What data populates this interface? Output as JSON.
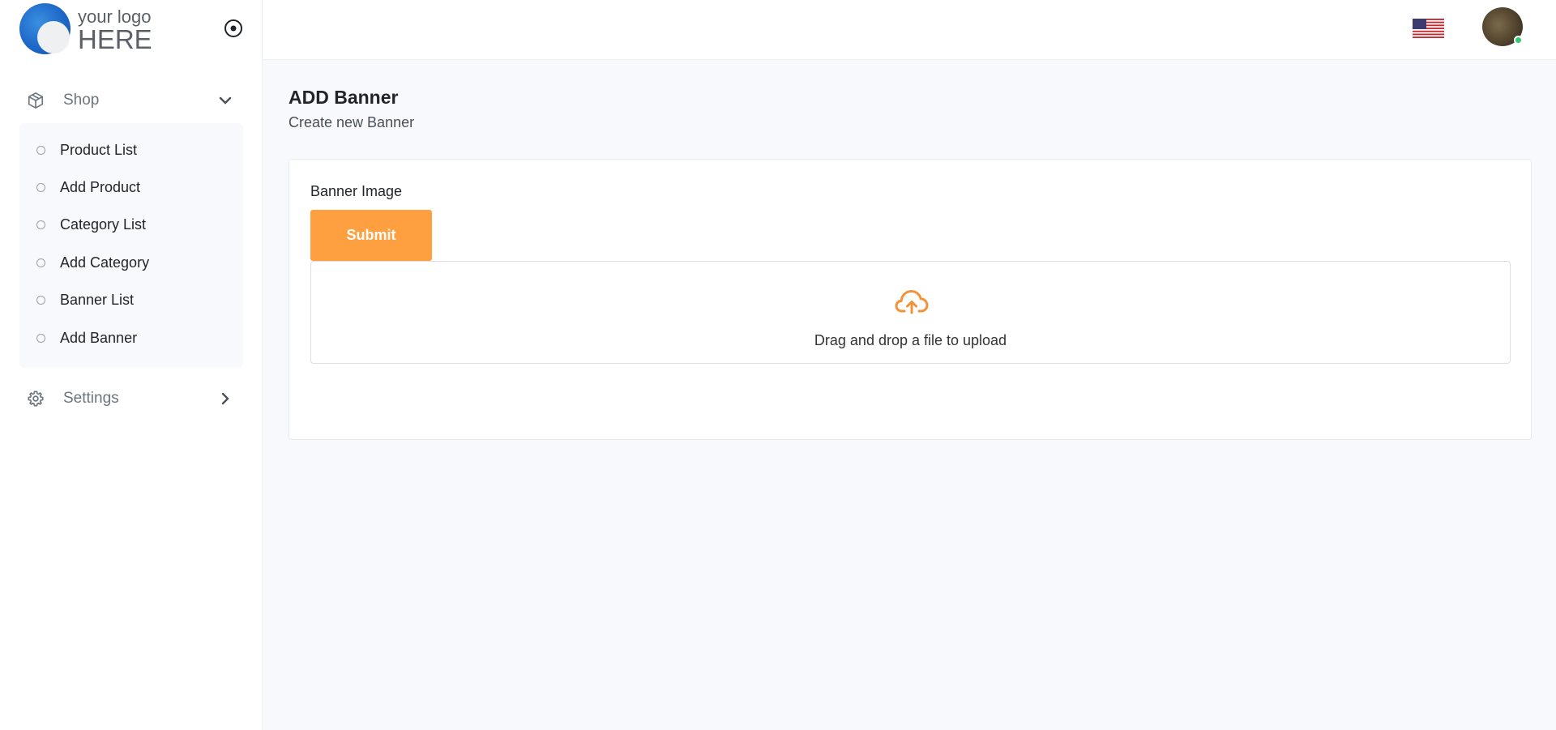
{
  "brand": {
    "line1": "your logo",
    "line2": "HERE"
  },
  "sidebar": {
    "shop_label": "Shop",
    "shop_items": [
      {
        "label": "Product List"
      },
      {
        "label": "Add Product"
      },
      {
        "label": "Category List"
      },
      {
        "label": "Add Category"
      },
      {
        "label": "Banner List"
      },
      {
        "label": "Add Banner"
      }
    ],
    "settings_label": "Settings"
  },
  "page": {
    "title": "ADD Banner",
    "subtitle": "Create new Banner"
  },
  "form": {
    "field_label": "Banner Image",
    "submit_label": "Submit",
    "dropzone_text": "Drag and drop a file to upload"
  },
  "colors": {
    "accent": "#ffa040",
    "online": "#2ecc71"
  }
}
